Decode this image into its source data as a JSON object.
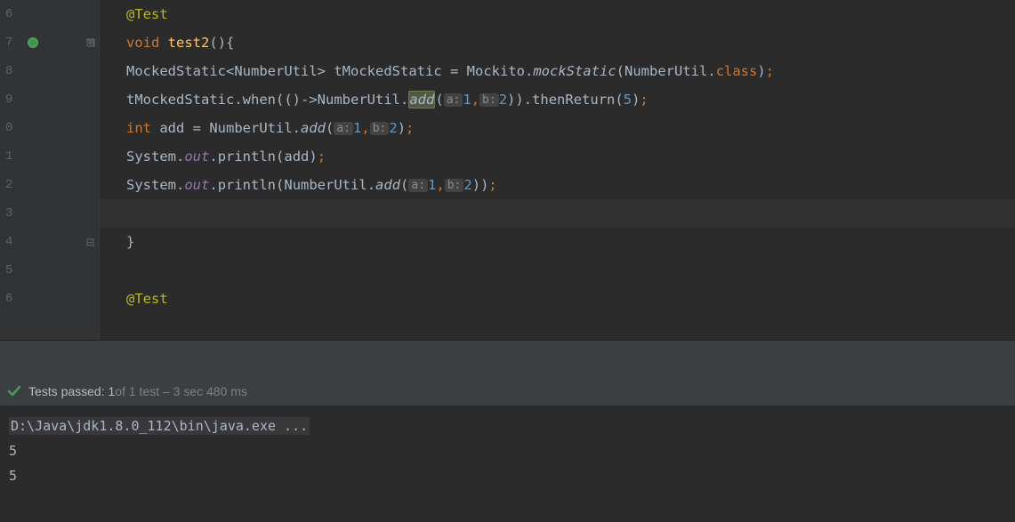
{
  "lines": {
    "l6": "6",
    "l7": "7",
    "l8": "8",
    "l9": "9",
    "l0": "0",
    "l1": "1",
    "l2": "2",
    "l3": "3",
    "l4": "4",
    "l5": "5",
    "l6b": "6"
  },
  "code": {
    "ann_test": "@Test",
    "kw_void": "void",
    "sp": " ",
    "fn_test2": "test2",
    "paren_open": "(",
    "paren_close": ")",
    "brace_open": "{",
    "brace_close": "}",
    "cls_MockedStatic": "MockedStatic",
    "lt": "<",
    "cls_NumberUtil": "NumberUtil",
    "gt": ">",
    "var_tMockedStatic": "tMockedStatic",
    "eq": " = ",
    "cls_Mockito": "Mockito",
    "dot": ".",
    "fn_mockStatic": "mockStatic",
    "kw_class": "class",
    "semi": ";",
    "fn_when": "when",
    "arrow": "()->",
    "fn_add": "add",
    "hint_a": "a:",
    "num_1": "1",
    "comma": ",",
    "hint_b": "b:",
    "num_2": "2",
    "fn_thenReturn": "thenReturn",
    "num_5": "5",
    "kw_int": "int",
    "var_add": "add",
    "cls_System": "System",
    "sf_out": "out",
    "fn_println": "println"
  },
  "status": {
    "passed_label": "Tests passed:",
    "passed_count": "1",
    "total_text": " of 1 test – 3 sec 480 ms"
  },
  "console": {
    "cmd": "D:\\Java\\jdk1.8.0_112\\bin\\java.exe ...",
    "out1": "5",
    "out2": "5"
  }
}
